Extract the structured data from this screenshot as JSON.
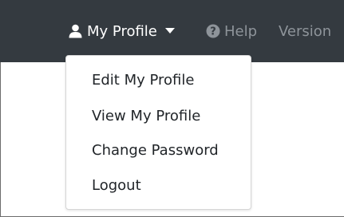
{
  "navbar": {
    "background": "#343a40",
    "profile_menu": {
      "label": "My Profile",
      "icon": "user-icon",
      "caret_icon": "caret-down-icon"
    },
    "help": {
      "label": "Help",
      "icon": "question-circle-icon"
    },
    "version": {
      "label": "Version"
    }
  },
  "dropdown": {
    "items": [
      {
        "label": "Edit My Profile"
      },
      {
        "label": "View My Profile"
      },
      {
        "label": "Change Password"
      },
      {
        "label": "Logout"
      }
    ]
  },
  "colors": {
    "navbar_bg": "#343a40",
    "active_text": "#ffffff",
    "muted_text": "#8e949a",
    "menu_text": "#212529"
  }
}
